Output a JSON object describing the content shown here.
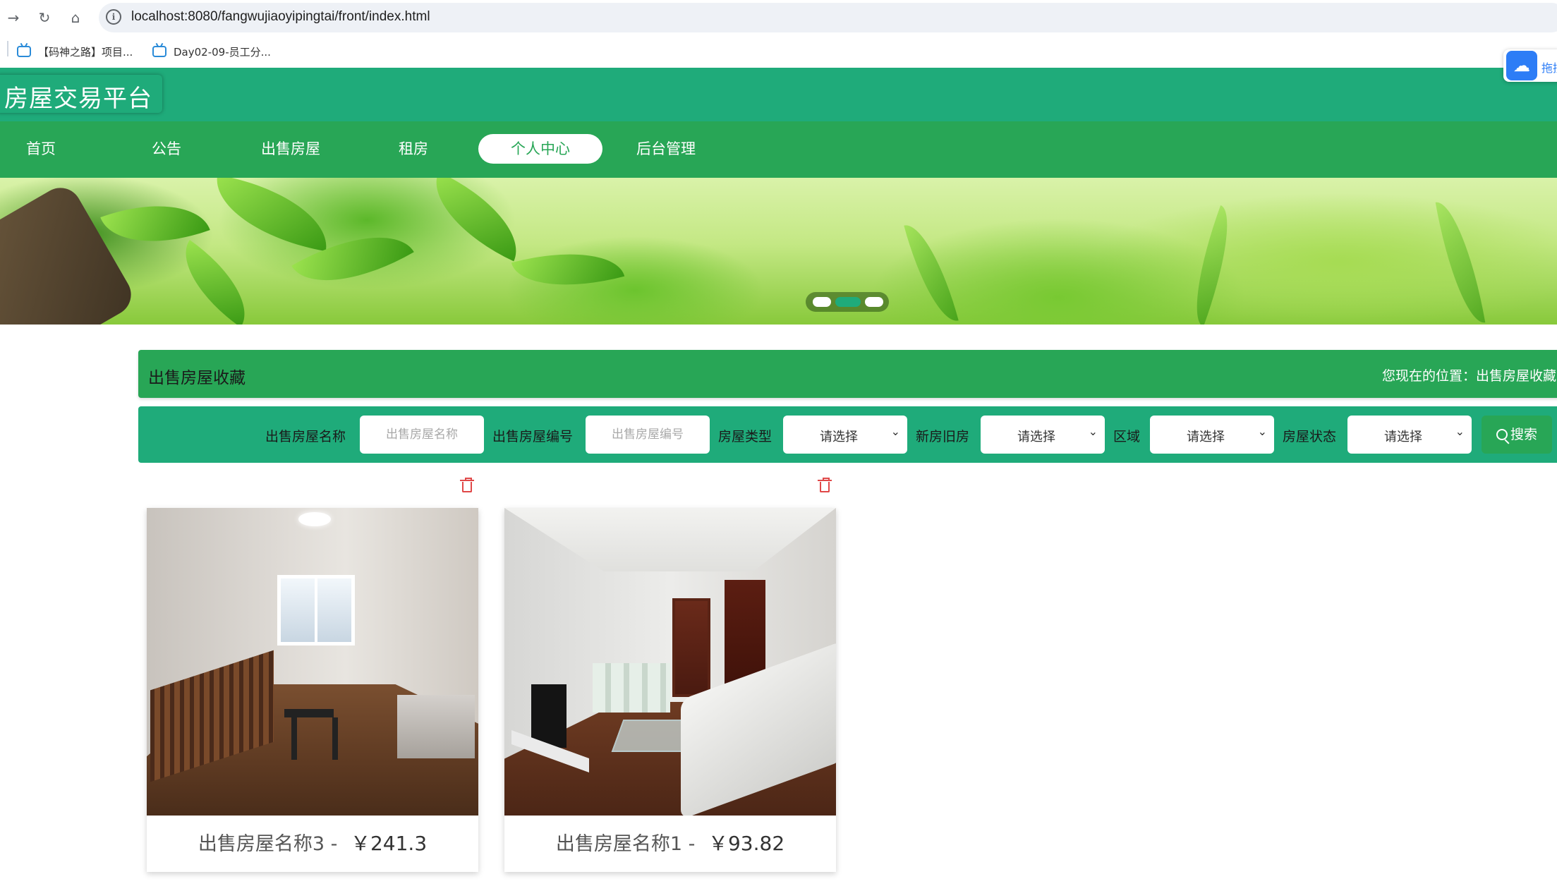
{
  "browser": {
    "url": "localhost:8080/fangwujiaoyipingtai/front/index.html",
    "bookmarks": [
      {
        "label": "【码神之路】项目..."
      },
      {
        "label": "Day02-09-员工分..."
      }
    ]
  },
  "header": {
    "brand": "房屋交易平台",
    "baidu_widget_text": "拖拽"
  },
  "nav": {
    "items": [
      {
        "label": "首页"
      },
      {
        "label": "公告"
      },
      {
        "label": "出售房屋"
      },
      {
        "label": "租房"
      },
      {
        "label": "个人中心",
        "active": true
      },
      {
        "label": "后台管理"
      }
    ]
  },
  "banner": {
    "slides": 3,
    "active_slide": 2
  },
  "breadcrumb": {
    "title": "出售房屋收藏",
    "position": "您现在的位置：出售房屋收藏"
  },
  "filters": {
    "name_label": "出售房屋名称",
    "name_placeholder": "出售房屋名称",
    "code_label": "出售房屋编号",
    "code_placeholder": "出售房屋编号",
    "type_label": "房屋类型",
    "type_value": "请选择",
    "age_label": "新房旧房",
    "age_value": "请选择",
    "area_label": "区域",
    "area_value": "请选择",
    "status_label": "房屋状态",
    "status_value": "请选择",
    "search_label": "搜索"
  },
  "cards": [
    {
      "name": "出售房屋名称3",
      "separator": "-",
      "price": "￥241.3"
    },
    {
      "name": "出售房屋名称1",
      "separator": "-",
      "price": "￥93.82"
    }
  ],
  "colors": {
    "header_green": "#1fab7a",
    "nav_green": "#28a656",
    "delete_red": "#e04848"
  }
}
